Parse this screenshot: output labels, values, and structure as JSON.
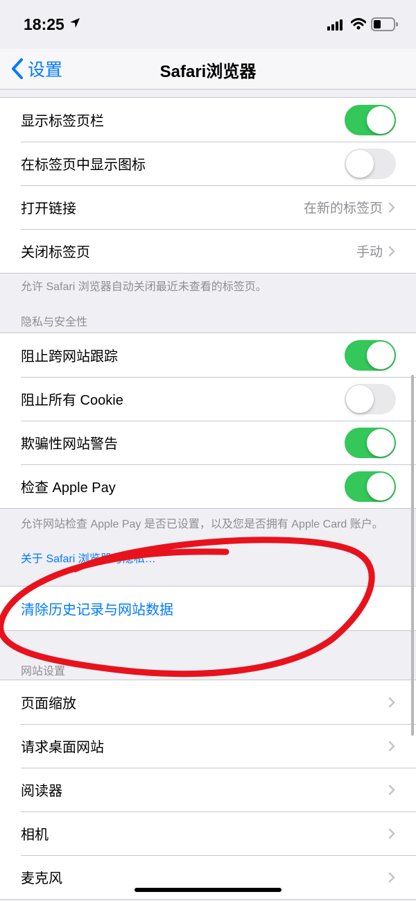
{
  "status_bar": {
    "time": "18:25"
  },
  "nav": {
    "back_label": "设置",
    "title": "Safari浏览器"
  },
  "tabs_group": [
    {
      "label": "显示标签页栏",
      "toggle": true
    },
    {
      "label": "在标签页中显示图标",
      "toggle": false
    },
    {
      "label": "打开链接",
      "value": "在新的标签页"
    },
    {
      "label": "关闭标签页",
      "value": "手动"
    }
  ],
  "tabs_footer": "允许 Safari 浏览器自动关闭最近未查看的标签页。",
  "privacy_header": "隐私与安全性",
  "privacy_group": [
    {
      "label": "阻止跨网站跟踪",
      "toggle": true
    },
    {
      "label": "阻止所有 Cookie",
      "toggle": false
    },
    {
      "label": "欺骗性网站警告",
      "toggle": true
    },
    {
      "label": "检查 Apple Pay",
      "toggle": true
    }
  ],
  "privacy_footer": "允许网站检查 Apple Pay 是否已设置，以及您是否拥有 Apple Card 账户。",
  "privacy_link": "关于 Safari 浏览器与隐私…",
  "clear_history_label": "清除历史记录与网站数据",
  "website_header": "网站设置",
  "website_group": [
    {
      "label": "页面缩放"
    },
    {
      "label": "请求桌面网站"
    },
    {
      "label": "阅读器"
    },
    {
      "label": "相机"
    },
    {
      "label": "麦克风"
    }
  ],
  "colors": {
    "accent": "#007aff",
    "toggle_on": "#34c759",
    "annotation": "#e8121c"
  }
}
